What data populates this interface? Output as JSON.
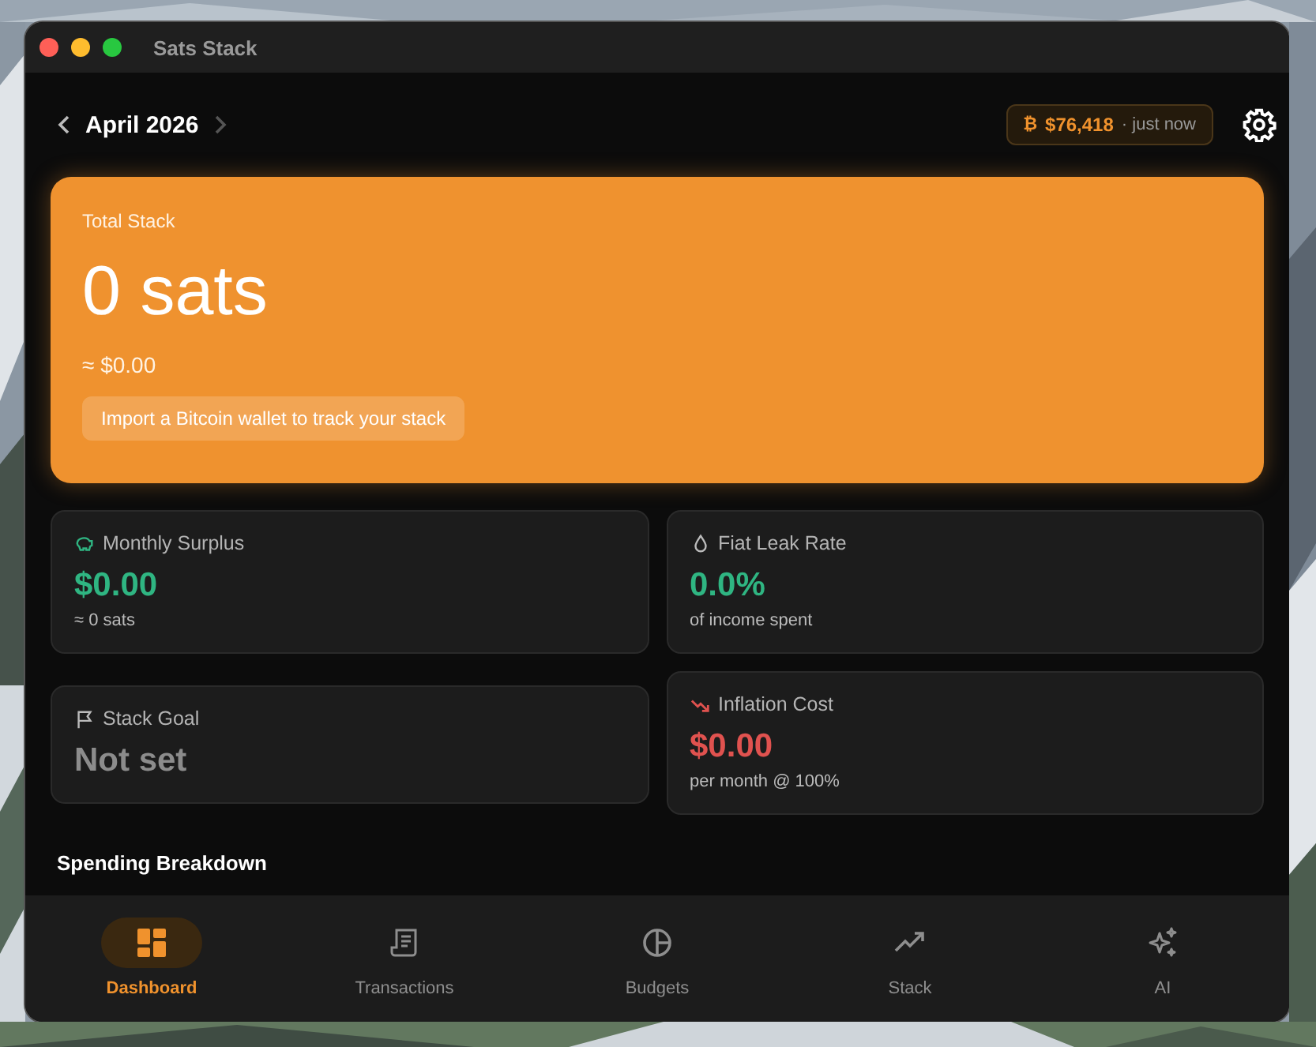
{
  "window": {
    "title": "Sats Stack"
  },
  "header": {
    "month": "April 2026",
    "price_symbol": "₿",
    "price": "$76,418",
    "price_age": "· just now"
  },
  "hero": {
    "label": "Total Stack",
    "value": "0 sats",
    "fiat": "≈ $0.00",
    "action": "Import a Bitcoin wallet to track your stack"
  },
  "cards": [
    {
      "title": "Monthly Surplus",
      "value": "$0.00",
      "caption": "≈ 0 sats"
    },
    {
      "title": "Stack Goal",
      "value": "Not set"
    },
    {
      "title": "Fiat Leak Rate",
      "value": "0.0%",
      "caption": "of income spent"
    },
    {
      "title": "Inflation Cost",
      "value": "$0.00",
      "caption": "per month @ 100%"
    }
  ],
  "section_title": "Spending Breakdown",
  "nav": [
    {
      "label": "Dashboard",
      "selected": true
    },
    {
      "label": "Transactions",
      "selected": false
    },
    {
      "label": "Budgets",
      "selected": false
    },
    {
      "label": "Stack",
      "selected": false
    },
    {
      "label": "AI",
      "selected": false
    }
  ]
}
